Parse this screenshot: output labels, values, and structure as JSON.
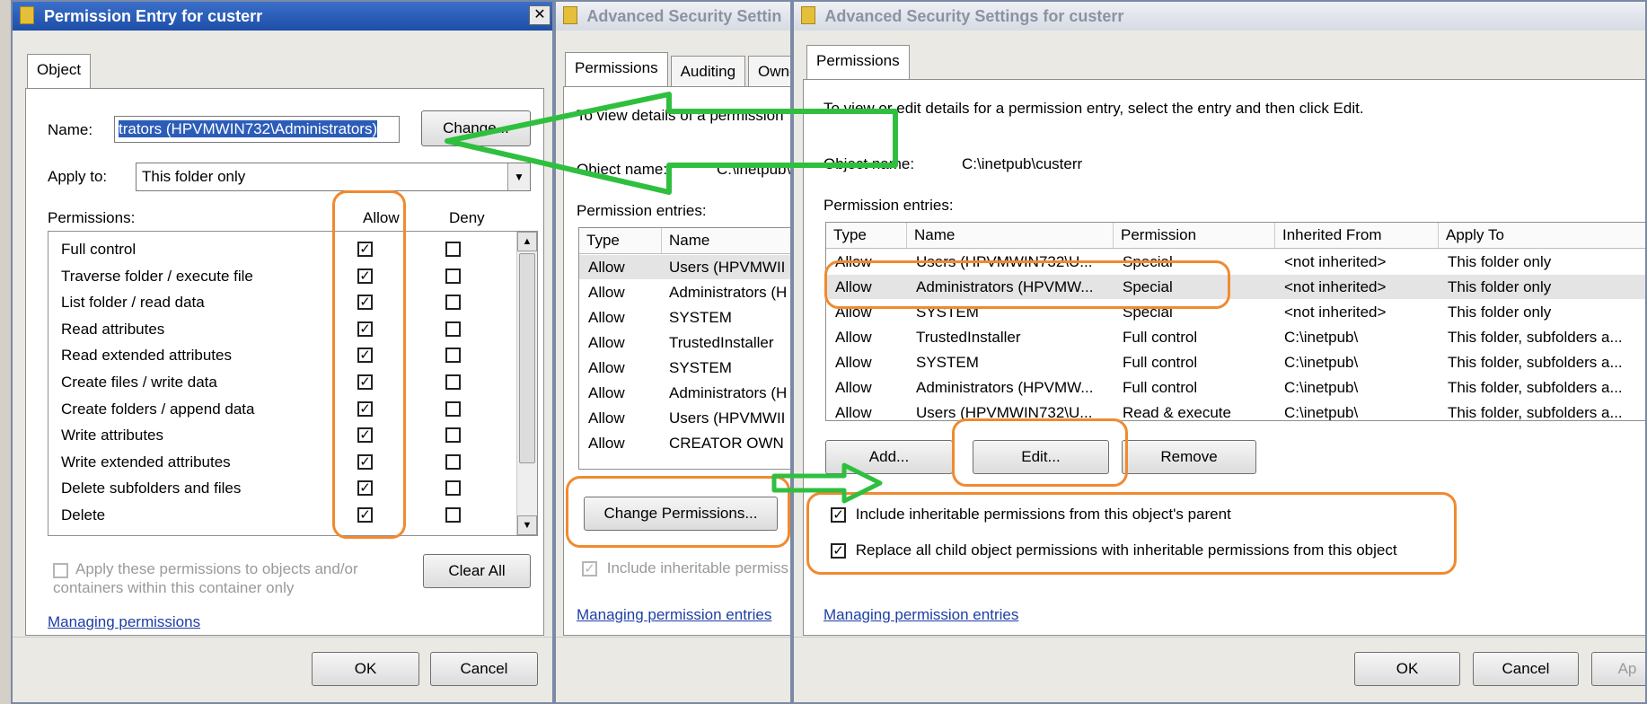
{
  "dialog1": {
    "title": "Permission Entry for custerr",
    "close": "✕",
    "tab": "Object",
    "name_label": "Name:",
    "name_value": "trators (HPVMWIN732\\Administrators)",
    "change_button": "Change...",
    "apply_to_label": "Apply to:",
    "apply_to_value": "This folder only",
    "permissions_label": "Permissions:",
    "allow_header": "Allow",
    "deny_header": "Deny",
    "permissions": [
      {
        "label": "Full control",
        "allow": true,
        "deny": false
      },
      {
        "label": "Traverse folder / execute file",
        "allow": true,
        "deny": false
      },
      {
        "label": "List folder / read data",
        "allow": true,
        "deny": false
      },
      {
        "label": "Read attributes",
        "allow": true,
        "deny": false
      },
      {
        "label": "Read extended attributes",
        "allow": true,
        "deny": false
      },
      {
        "label": "Create files / write data",
        "allow": true,
        "deny": false
      },
      {
        "label": "Create folders / append data",
        "allow": true,
        "deny": false
      },
      {
        "label": "Write attributes",
        "allow": true,
        "deny": false
      },
      {
        "label": "Write extended attributes",
        "allow": true,
        "deny": false
      },
      {
        "label": "Delete subfolders and files",
        "allow": true,
        "deny": false
      },
      {
        "label": "Delete",
        "allow": true,
        "deny": false
      }
    ],
    "apply_children_text": "Apply these permissions to objects and/or containers within this container only",
    "clear_all_button": "Clear All",
    "help_link": "Managing permissions",
    "ok_button": "OK",
    "cancel_button": "Cancel"
  },
  "dialog2": {
    "title": "Advanced Security Settin",
    "tabs": [
      "Permissions",
      "Auditing",
      "Owner"
    ],
    "info_text": "To view details of a permission",
    "object_name_label": "Object name:",
    "object_name_value": "C:\\inetpub\\",
    "entries_label": "Permission entries:",
    "col_type": "Type",
    "col_name": "Name",
    "entries": [
      {
        "type": "Allow",
        "name": "Users (HPVMWII"
      },
      {
        "type": "Allow",
        "name": "Administrators (H"
      },
      {
        "type": "Allow",
        "name": "SYSTEM"
      },
      {
        "type": "Allow",
        "name": "TrustedInstaller"
      },
      {
        "type": "Allow",
        "name": "SYSTEM"
      },
      {
        "type": "Allow",
        "name": "Administrators (H"
      },
      {
        "type": "Allow",
        "name": "Users (HPVMWII"
      },
      {
        "type": "Allow",
        "name": "CREATOR OWN"
      }
    ],
    "change_permissions_button": "Change Permissions...",
    "include_inheritable_text": "Include inheritable permiss",
    "help_link": "Managing permission entries"
  },
  "dialog3": {
    "title": "Advanced Security Settings for custerr",
    "tab": "Permissions",
    "info_text": "To view or edit details for a permission entry, select the entry and then click Edit.",
    "object_name_label": "Object name:",
    "object_name_value": "C:\\inetpub\\custerr",
    "entries_label": "Permission entries:",
    "columns": [
      "Type",
      "Name",
      "Permission",
      "Inherited From",
      "Apply To"
    ],
    "entries": [
      {
        "type": "Allow",
        "name": "Users (HPVMWIN732\\U...",
        "permission": "Special",
        "inherited": "<not inherited>",
        "apply": "This folder only"
      },
      {
        "type": "Allow",
        "name": "Administrators (HPVMW...",
        "permission": "Special",
        "inherited": "<not inherited>",
        "apply": "This folder only"
      },
      {
        "type": "Allow",
        "name": "SYSTEM",
        "permission": "Special",
        "inherited": "<not inherited>",
        "apply": "This folder only"
      },
      {
        "type": "Allow",
        "name": "TrustedInstaller",
        "permission": "Full control",
        "inherited": "C:\\inetpub\\",
        "apply": "This folder, subfolders a..."
      },
      {
        "type": "Allow",
        "name": "SYSTEM",
        "permission": "Full control",
        "inherited": "C:\\inetpub\\",
        "apply": "This folder, subfolders a..."
      },
      {
        "type": "Allow",
        "name": "Administrators (HPVMW...",
        "permission": "Full control",
        "inherited": "C:\\inetpub\\",
        "apply": "This folder, subfolders a..."
      },
      {
        "type": "Allow",
        "name": "Users (HPVMWIN732\\U...",
        "permission": "Read & execute",
        "inherited": "C:\\inetpub\\",
        "apply": "This folder, subfolders a..."
      }
    ],
    "add_button": "Add...",
    "edit_button": "Edit...",
    "remove_button": "Remove",
    "include_inheritable_text": "Include inheritable permissions from this object's parent",
    "replace_child_text": "Replace all child object permissions with inheritable permissions from this object",
    "help_link": "Managing permission entries",
    "ok_button": "OK",
    "cancel_button": "Cancel",
    "apply_button": "Ap"
  },
  "colors": {
    "highlight_orange": "#f08a30",
    "arrow_green": "#2fbf3f",
    "title_active": "#1e4fa8",
    "link_blue": "#1d3fa4"
  }
}
